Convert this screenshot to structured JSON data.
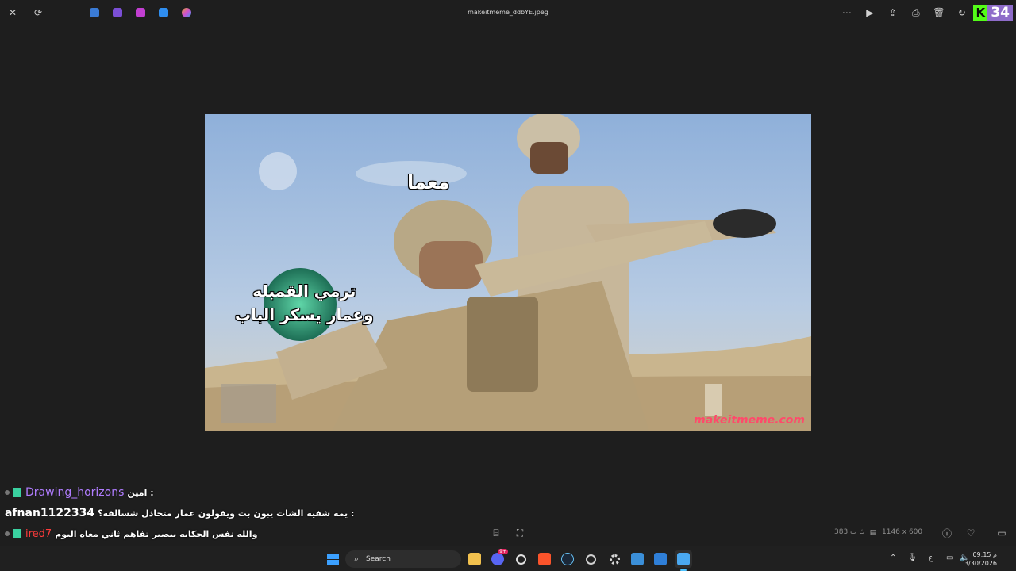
{
  "titlebar": {
    "title": "makeitmeme_ddbYE.jpeg",
    "close_glyph": "✕",
    "restore_glyph": "⟳",
    "minimize_glyph": "—",
    "apps": [
      {
        "name": "onedrive-icon",
        "color": "#3a7bd5"
      },
      {
        "name": "clipchamp-icon",
        "color": "#7b4fd6"
      },
      {
        "name": "designer-icon",
        "color": "#c23fd1"
      },
      {
        "name": "photos-edit-icon",
        "color": "#2f8ef0"
      },
      {
        "name": "copilot-icon",
        "color": "#e0a030"
      }
    ],
    "tools": [
      {
        "name": "more-options-icon",
        "glyph": "⋯"
      },
      {
        "name": "slideshow-icon",
        "glyph": "▶"
      },
      {
        "name": "share-icon",
        "glyph": "⇪"
      },
      {
        "name": "print-icon",
        "glyph": "⎙"
      },
      {
        "name": "delete-icon",
        "glyph": "🗑"
      },
      {
        "name": "rotate-icon",
        "glyph": "↻"
      }
    ],
    "kick_badge": {
      "letter": "K",
      "count": "34"
    }
  },
  "meme": {
    "caption_top": "معما",
    "caption_left_line1": "ترمي القمبله",
    "caption_left_line2": "وعمار يسكر الباب",
    "watermark": "makeitmeme.com"
  },
  "chat": [
    {
      "user": "Drawing_horizons",
      "message": ": امين",
      "style": "purple"
    },
    {
      "user": "afnan1122334",
      "message": ": يمه شفيه الشات يبون بث ويقولون عمار متخاذل شسالفه؟",
      "style": "white"
    },
    {
      "user": "ired7",
      "message": "والله نفس الحكايه بيصير تفاهم ثاني معاه اليوم",
      "style": "red"
    }
  ],
  "infobar": {
    "file_size": "383 ك ب",
    "dimensions": "1146 x 600",
    "info_glyph": "ⓘ",
    "favorite_glyph": "♡",
    "fit_glyph": "▭"
  },
  "taskbar": {
    "search_placeholder": "Search",
    "discord_badge": "9+",
    "time": "09:15 م",
    "date": "3/30/2026",
    "lang": "ع",
    "accent": "#4cc2ff"
  }
}
